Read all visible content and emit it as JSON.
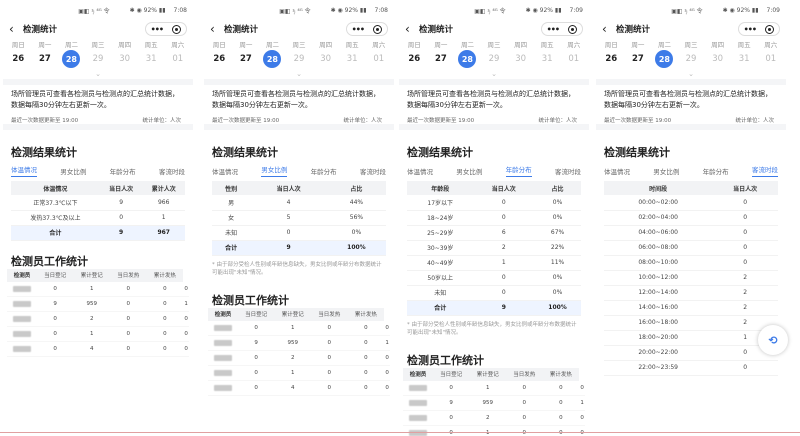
{
  "status_icons": "▣◧ ᵌ᷊ₗ ⁴ᴳ 令",
  "status_battery": "✱ ◉ 92% ▮▮",
  "status_times": [
    "7:08",
    "7:08",
    "7:09",
    "7:09"
  ],
  "title": "检测统计",
  "capsule_dots": "•••",
  "weekdays": [
    "周日",
    "周一",
    "周二",
    "周三",
    "周四",
    "周五",
    "周六"
  ],
  "dates": [
    "26",
    "27",
    "28",
    "29",
    "30",
    "31",
    "01"
  ],
  "selected_index": 2,
  "chevron": "⌄",
  "description": "场所管理员可查看各检测员与检测点的汇总统计数据，数据每隔30分钟左右更新一次。",
  "last_update": "最近一次数据更新至 19:00",
  "unit": "统计单位：人次",
  "section_title": "检测结果统计",
  "tabs": [
    "体温情况",
    "男女比例",
    "年龄分布",
    "客流时段"
  ],
  "temp_table": {
    "headers": [
      "体温情况",
      "当日人次",
      "累计人次"
    ],
    "rows": [
      [
        "正常37.3℃以下",
        "9",
        "966"
      ],
      [
        "发热37.3℃及以上",
        "0",
        "1"
      ]
    ],
    "total": [
      "合计",
      "9",
      "967"
    ]
  },
  "gender_table": {
    "headers": [
      "性别",
      "当日人次",
      "占比"
    ],
    "rows": [
      [
        "男",
        "4",
        "44%"
      ],
      [
        "女",
        "5",
        "56%"
      ],
      [
        "未知",
        "0",
        "0%"
      ]
    ],
    "total": [
      "合计",
      "9",
      "100%"
    ]
  },
  "age_table": {
    "headers": [
      "年龄段",
      "当日人次",
      "占比"
    ],
    "rows": [
      [
        "17岁以下",
        "0",
        "0%"
      ],
      [
        "18~24岁",
        "0",
        "0%"
      ],
      [
        "25~29岁",
        "6",
        "67%"
      ],
      [
        "30~39岁",
        "2",
        "22%"
      ],
      [
        "40~49岁",
        "1",
        "11%"
      ],
      [
        "50岁以上",
        "0",
        "0%"
      ],
      [
        "未知",
        "0",
        "0%"
      ]
    ],
    "total": [
      "合计",
      "9",
      "100%"
    ]
  },
  "time_table": {
    "headers": [
      "时间段",
      "当日人次"
    ],
    "rows": [
      [
        "00:00~02:00",
        "0"
      ],
      [
        "02:00~04:00",
        "0"
      ],
      [
        "04:00~06:00",
        "0"
      ],
      [
        "06:00~08:00",
        "0"
      ],
      [
        "08:00~10:00",
        "0"
      ],
      [
        "10:00~12:00",
        "2"
      ],
      [
        "12:00~14:00",
        "2"
      ],
      [
        "14:00~16:00",
        "2"
      ],
      [
        "16:00~18:00",
        "2"
      ],
      [
        "18:00~20:00",
        "1"
      ],
      [
        "20:00~22:00",
        "0"
      ],
      [
        "22:00~23:59",
        "0"
      ]
    ]
  },
  "note": "* 由于部分受检人性别或年龄信息缺失，男女比例或年龄分布数据统计可能出现\"未知\"情况。",
  "worker_title": "检测员工作统计",
  "worker_table": {
    "headers": [
      "检测员",
      "当日登记",
      "累计登记",
      "当日发热",
      "累计发热"
    ],
    "rows": [
      [
        "1",
        "0",
        "0",
        "0"
      ],
      [
        "959",
        "0",
        "0",
        "1"
      ],
      [
        "2",
        "0",
        "0",
        "0"
      ],
      [
        "1",
        "0",
        "0",
        "0"
      ],
      [
        "4",
        "0",
        "0",
        "0"
      ]
    ],
    "rows_today": [
      "0",
      "9",
      "0",
      "0",
      "0"
    ]
  },
  "float_icon": "⟲"
}
